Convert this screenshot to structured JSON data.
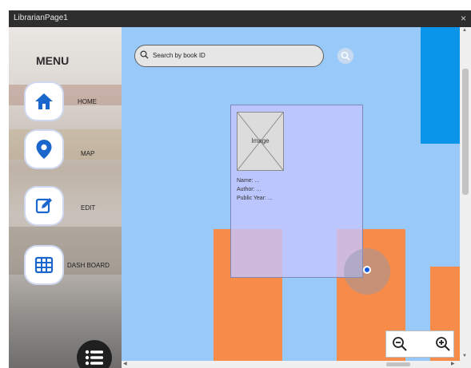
{
  "window": {
    "title": "LibrarianPage1",
    "close_glyph": "×"
  },
  "sidebar": {
    "menu_title": "MENU",
    "items": [
      {
        "label": "HOME",
        "icon": "home-icon"
      },
      {
        "label": "MAP",
        "icon": "map-pin-icon"
      },
      {
        "label": "EDIT",
        "icon": "edit-icon"
      },
      {
        "label": "DASH BOARD",
        "icon": "grid-table-icon"
      }
    ],
    "menu_button_icon": "list-menu-icon"
  },
  "search": {
    "placeholder": "Search by book ID"
  },
  "book_card": {
    "image_label": "Image",
    "name_line": "Name: ...",
    "author_line": "Author: ...",
    "year_line": "Public Year: ..."
  },
  "zoom": {
    "out_icon": "zoom-out-icon",
    "in_icon": "zoom-in-icon"
  },
  "colors": {
    "map_background": "#99c9f9",
    "blue_building": "#0a94ea",
    "orange_building": "#f78c4a",
    "card_overlay": "#c4c6ff",
    "location_dot": "#1458e6"
  }
}
